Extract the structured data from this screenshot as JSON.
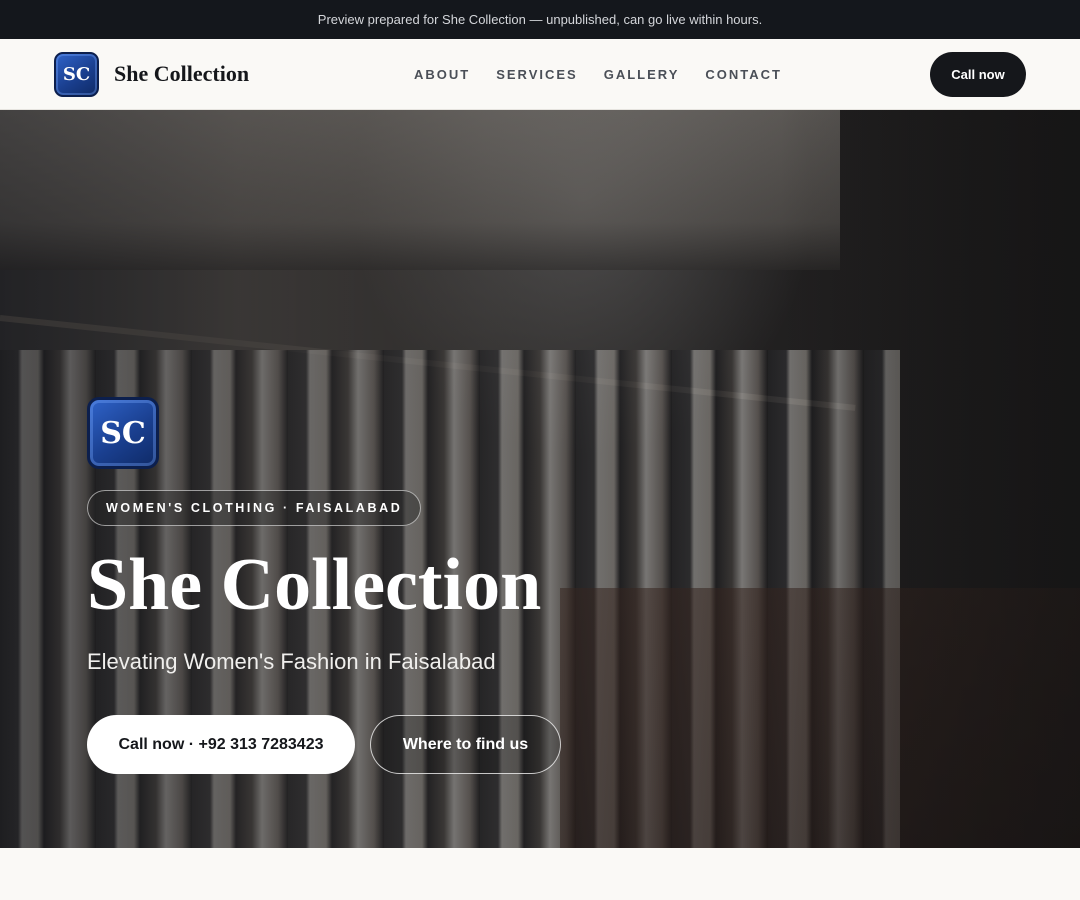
{
  "preview_banner": "Preview prepared for She Collection — unpublished, can go live within hours.",
  "brand": {
    "logo_text": "SC",
    "name": "She Collection"
  },
  "nav": {
    "items": [
      "ABOUT",
      "SERVICES",
      "GALLERY",
      "CONTACT"
    ],
    "cta": "Call now"
  },
  "hero": {
    "logo_text": "SC",
    "tag": "WOMEN'S CLOTHING · FAISALABAD",
    "title": "She Collection",
    "subtitle": "Elevating Women's Fashion in Faisalabad",
    "primary_cta": "Call now · +92 313 7283423",
    "secondary_cta": "Where to find us"
  },
  "colors": {
    "dark": "#15171b",
    "accent_blue": "#1a3f8f",
    "background": "#faf9f6"
  }
}
